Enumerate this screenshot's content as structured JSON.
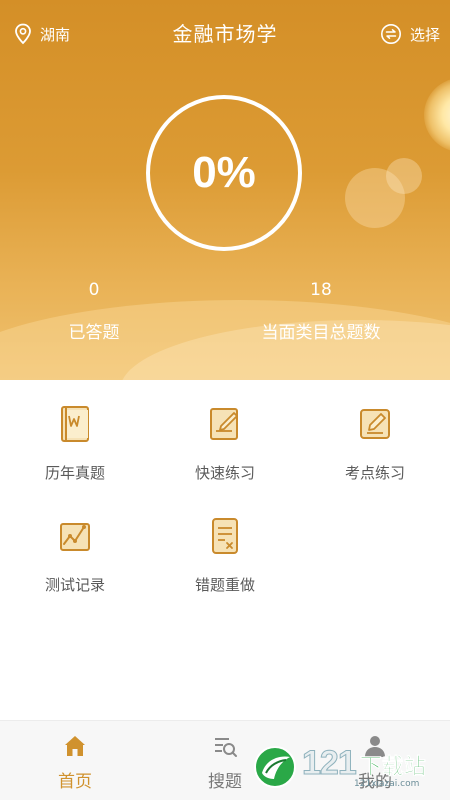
{
  "header": {
    "location": "湖南",
    "title": "金融市场学",
    "select_label": "选择"
  },
  "progress": {
    "percent_text": "0%",
    "answered_count": "0",
    "answered_label": "已答题",
    "total_count": "18",
    "total_label": "当面类目总题数"
  },
  "features": [
    {
      "label": "历年真题",
      "icon": "book-icon"
    },
    {
      "label": "快速练习",
      "icon": "edit-note-icon"
    },
    {
      "label": "考点练习",
      "icon": "pencil-note-icon"
    },
    {
      "label": "测试记录",
      "icon": "chart-trend-icon"
    },
    {
      "label": "错题重做",
      "icon": "document-x-icon"
    }
  ],
  "tabbar": {
    "items": [
      {
        "label": "首页",
        "icon": "home-icon"
      },
      {
        "label": "搜题",
        "icon": "search-list-icon"
      },
      {
        "label": "我的",
        "icon": "user-icon"
      }
    ]
  },
  "watermark": {
    "number": "121",
    "text": "下载站",
    "url": "121xiazai.com"
  },
  "colors": {
    "accent": "#d0922e",
    "hero_top": "#d48f27",
    "hero_bottom": "#efc270",
    "icon": "#c98a2c"
  }
}
